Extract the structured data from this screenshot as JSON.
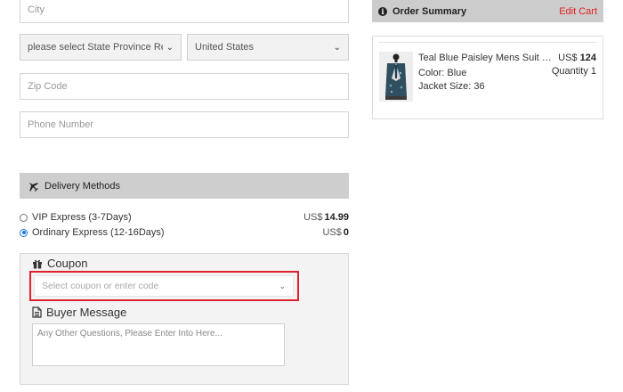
{
  "form": {
    "city_placeholder": "City",
    "state_select_value": "please select State Province Region",
    "country_select_value": "United States",
    "zip_placeholder": "Zip Code",
    "phone_placeholder": "Phone Number"
  },
  "delivery": {
    "header": "Delivery Methods",
    "methods": [
      {
        "label": "VIP Express (3-7Days)",
        "currency": "US$",
        "price": "14.99",
        "selected": false
      },
      {
        "label": "Ordinary Express (12-16Days)",
        "currency": "US$",
        "price": "0",
        "selected": true
      }
    ]
  },
  "coupon": {
    "title": "Coupon",
    "select_placeholder": "Select coupon or enter code"
  },
  "buyer_message": {
    "title": "Buyer Message",
    "placeholder": "Any Other Questions, Please Enter Into Here..."
  },
  "order_summary": {
    "title": "Order Summary",
    "edit_label": "Edit Cart",
    "item": {
      "name": "Teal Blue Paisley Mens Suit Pro...",
      "color": "Color: Blue",
      "size": "Jacket Size: 36",
      "currency": "US$",
      "price": "124",
      "quantity": "Quantity 1"
    }
  },
  "icons": {
    "delivery": "airplane-icon",
    "coupon": "gift-icon",
    "message": "document-icon",
    "summary": "info-icon"
  },
  "colors": {
    "accent_red": "#e0212f",
    "radio_blue": "#1a73e8",
    "header_gray": "#cecece"
  }
}
